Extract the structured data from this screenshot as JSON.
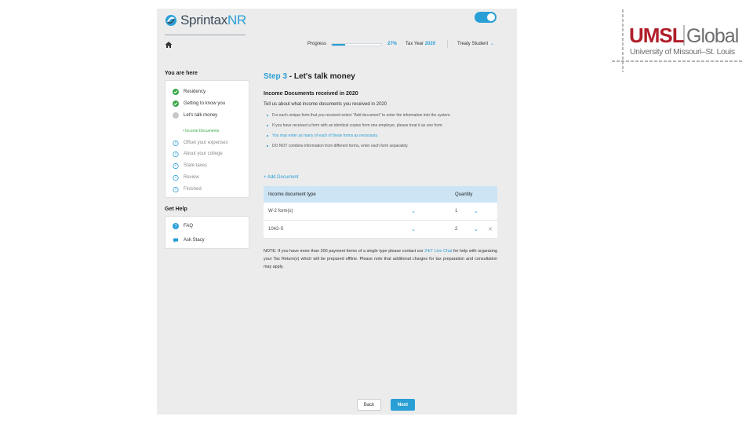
{
  "app": {
    "logo_prefix": "Sprintax",
    "logo_suffix": "NR",
    "progress_label": "Progress",
    "progress_value": 0.27,
    "progress_percent": "27%",
    "tax_year_label": "Tax Year",
    "tax_year_value": "2020",
    "treaty_label": "Treaty Student"
  },
  "sidebar": {
    "you_are_here": "You are here",
    "items": [
      {
        "label": "Residency",
        "state": "done"
      },
      {
        "label": "Getting to know you",
        "state": "done"
      },
      {
        "label": "Let's talk money",
        "state": "current"
      },
      {
        "label": "Offset your expenses",
        "state": "todo"
      },
      {
        "label": "About your college",
        "state": "todo"
      },
      {
        "label": "State taxes",
        "state": "todo"
      },
      {
        "label": "Review",
        "state": "todo"
      },
      {
        "label": "Finished",
        "state": "todo"
      }
    ],
    "current_sub": "Income Documents",
    "get_help": "Get Help",
    "help_items": [
      {
        "label": "FAQ",
        "icon": "question-icon"
      },
      {
        "label": "Ask Stacy",
        "icon": "chat-icon"
      }
    ]
  },
  "main": {
    "step_prefix": "Step 3",
    "step_title": " - Let's talk money",
    "section_title": "Income Documents received in 2020",
    "intro": "Tell us about what income documents you received in 2020",
    "bullets": [
      "For each unique form that you received select \"Add document\" to enter the information into the system.",
      "If you have received a form with an identical copies from one employer, please treat it as one form.",
      "You may enter as many of each of these forms as necessary.",
      "DO NOT combine information from different forms, enter each form separately."
    ],
    "add_document": "+ Add Document",
    "table": {
      "col_type": "Income document type",
      "col_qty": "Quantity",
      "rows": [
        {
          "type": "W-2 form(s)",
          "qty": "1"
        },
        {
          "type": "1042-S",
          "qty": "2"
        }
      ]
    },
    "note_a": "NOTE: If you have more than 200 payment forms of a single type please contact our ",
    "note_link": "24/7 Live Chat",
    "note_b": " for help with organizing your Tax Return(s) which will be prepared offline. Please note that additional charges for tax preparation and consultation may apply.",
    "back_label": "Back",
    "next_label": "Next"
  },
  "brand": {
    "umsl_text": "UMSL Global University of Missouri–St. Louis",
    "accent": "#2a9fd6",
    "umsl_red": "#b01e2a",
    "success": "#3aa84a"
  }
}
